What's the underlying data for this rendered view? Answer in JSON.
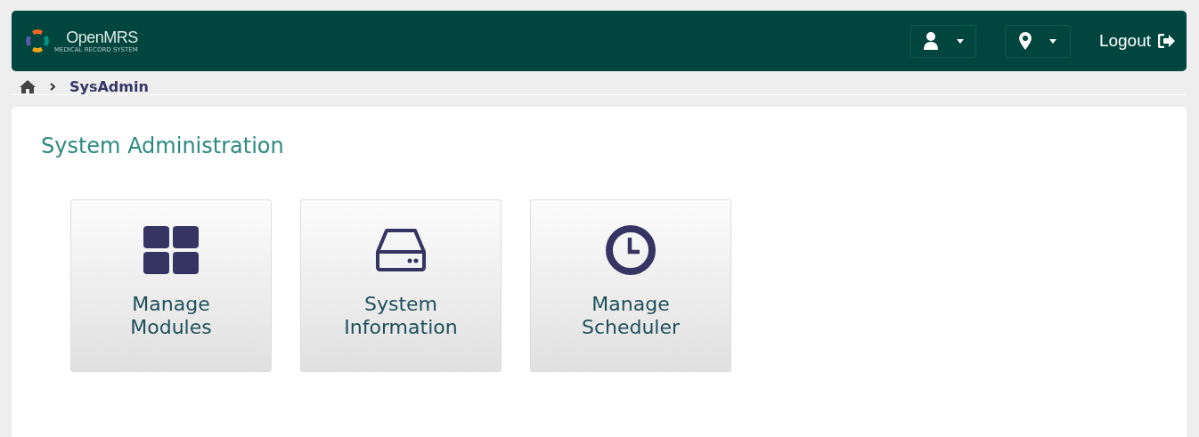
{
  "header": {
    "logo": {
      "name": "OpenMRS",
      "tagline": "MEDICAL RECORD SYSTEM"
    },
    "logout": "Logout"
  },
  "breadcrumb": {
    "current": "SysAdmin"
  },
  "page": {
    "title": "System Administration",
    "tiles": [
      {
        "kind": "modules",
        "label": "Manage Modules"
      },
      {
        "kind": "info",
        "label": "System Information"
      },
      {
        "kind": "scheduler",
        "label": "Manage Scheduler"
      }
    ]
  }
}
